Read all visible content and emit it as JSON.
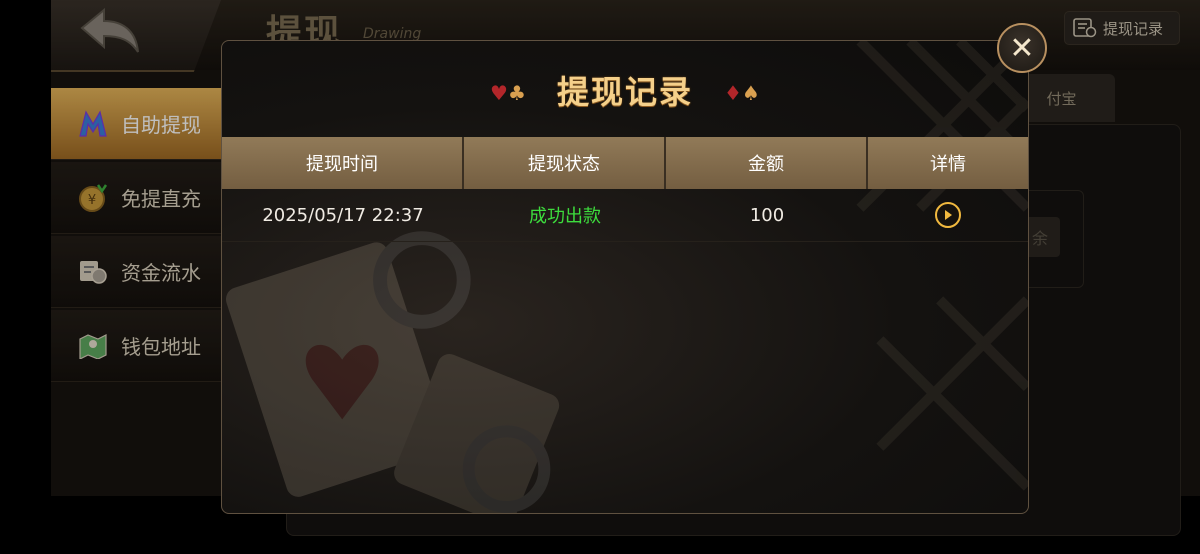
{
  "header": {
    "title": "提现",
    "subtitle": "Drawing",
    "record_button": "提现记录"
  },
  "sidebar": {
    "items": [
      {
        "label": "自助提现",
        "icon": "m-logo-icon"
      },
      {
        "label": "免提直充",
        "icon": "coin-icon"
      },
      {
        "label": "资金流水",
        "icon": "ledger-icon"
      },
      {
        "label": "钱包地址",
        "icon": "map-icon"
      }
    ]
  },
  "background": {
    "tab_label": "付宝",
    "field_text": "余"
  },
  "modal": {
    "title": "提现记录",
    "columns": [
      "提现时间",
      "提现状态",
      "金额",
      "详情"
    ],
    "rows": [
      {
        "time": "2025/05/17 22:37",
        "status": "成功出款",
        "amount": "100"
      }
    ],
    "colors": {
      "status_success": "#3ddc3d",
      "title": "#f5d08a",
      "accent": "#f1b93f"
    }
  }
}
